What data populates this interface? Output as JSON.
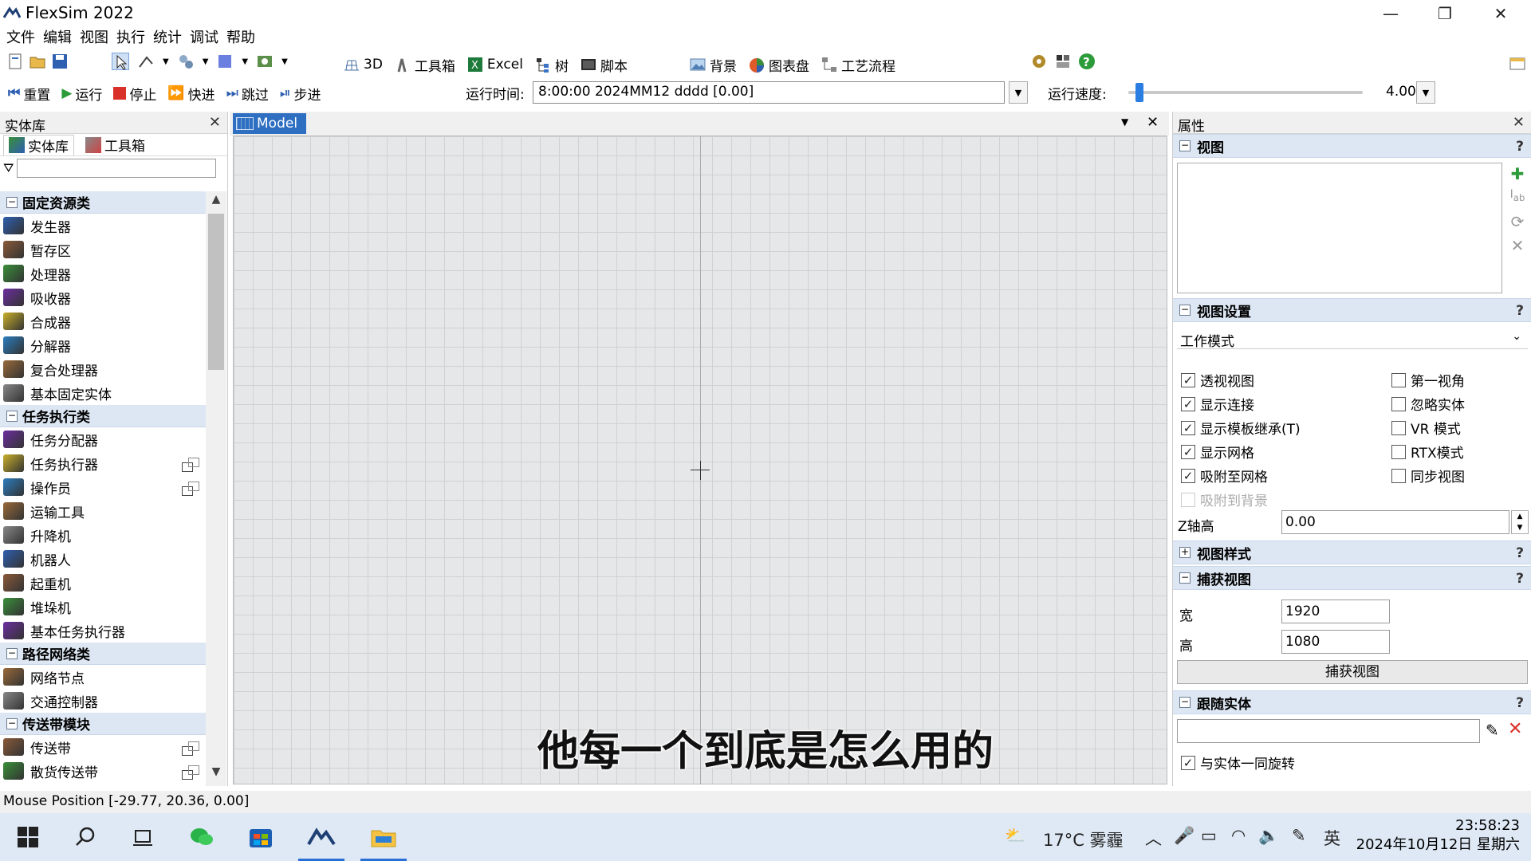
{
  "window": {
    "title": "FlexSim 2022"
  },
  "menubar": [
    "文件",
    "编辑",
    "视图",
    "执行",
    "统计",
    "调试",
    "帮助"
  ],
  "toolbar": {
    "view3d": "3D",
    "toolbox": "工具箱",
    "excel": "Excel",
    "tree": "树",
    "script": "脚本",
    "background": "背景",
    "dashboard": "图表盘",
    "process_flow": "工艺流程"
  },
  "runbar": {
    "reset": "重置",
    "run": "运行",
    "stop": "停止",
    "fast": "快进",
    "skip": "跳过",
    "step": "步进",
    "runtime_label": "运行时间:",
    "runtime_value": "8:00:00  2024MM12 dddd  [0.00]",
    "speed_label": "运行速度:",
    "speed_value": "4.00",
    "speed_fraction": 0.03
  },
  "library": {
    "header": "实体库",
    "tabs": [
      "实体库",
      "工具箱"
    ],
    "categories": [
      {
        "name": "固定资源类",
        "items": [
          "发生器",
          "暂存区",
          "处理器",
          "吸收器",
          "合成器",
          "分解器",
          "复合处理器",
          "基本固定实体"
        ]
      },
      {
        "name": "任务执行类",
        "items": [
          "任务分配器",
          "任务执行器",
          "操作员",
          "运输工具",
          "升降机",
          "机器人",
          "起重机",
          "堆垛机",
          "基本任务执行器"
        ]
      },
      {
        "name": "路径网络类",
        "items": [
          "网络节点",
          "交通控制器"
        ]
      },
      {
        "name": "传送带模块",
        "items": [
          "传送带",
          "散货传送带"
        ]
      }
    ]
  },
  "model": {
    "tab": "Model"
  },
  "subtitle": "他每一个到底是怎么用的",
  "properties": {
    "header": "属性",
    "view_section": "视图",
    "view_settings_section": "视图设置",
    "mode": "工作模式",
    "checks_left": [
      {
        "label": "透视视图",
        "checked": true
      },
      {
        "label": "显示连接",
        "checked": true
      },
      {
        "label": "显示模板继承(T)",
        "checked": true
      },
      {
        "label": "显示网格",
        "checked": true
      },
      {
        "label": "吸附至网格",
        "checked": true
      },
      {
        "label": "吸附到背景",
        "checked": false,
        "disabled": true
      }
    ],
    "checks_right": [
      {
        "label": "第一视角",
        "checked": false
      },
      {
        "label": "忽略实体",
        "checked": false
      },
      {
        "label": "VR 模式",
        "checked": false
      },
      {
        "label": "RTX模式",
        "checked": false
      },
      {
        "label": "同步视图",
        "checked": false
      }
    ],
    "z_label": "Z轴高",
    "z_value": "0.00",
    "view_style_section": "视图样式",
    "capture_section": "捕获视图",
    "width_label": "宽",
    "width_value": "1920",
    "height_label": "高",
    "height_value": "1080",
    "capture_button": "捕获视图",
    "follow_section": "跟随实体",
    "rotate_label": "与实体一同旋转",
    "rotate_checked": true
  },
  "statusbar": "Mouse Position [-29.77, 20.36, 0.00]",
  "taskbar": {
    "weather": "17°C 雾霾",
    "ime": "英",
    "time": "23:58:23",
    "date": "2024年10月12日 星期六"
  },
  "colors": {
    "accent": "#2e6fc2",
    "category_bg": "#dde7f3",
    "grid_bg": "#e6e7e8"
  }
}
